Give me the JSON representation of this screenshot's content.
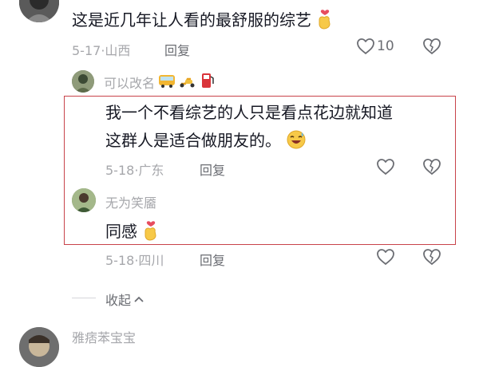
{
  "comment": {
    "text": "这是近几年让人看的最舒服的综艺",
    "date": "5-17",
    "location": "山西",
    "reply_label": "回复",
    "likes": "10"
  },
  "reply_header": {
    "username": "可以改名"
  },
  "reply1": {
    "text_line1": "我一个不看综艺的人只是看点花边就知道",
    "text_line2": "这群人是适合做朋友的。",
    "date": "5-18",
    "location": "广东",
    "reply_label": "回复"
  },
  "reply2": {
    "username": "无为笑靥",
    "text": "同感",
    "date": "5-18",
    "location": "四川",
    "reply_label": "回复"
  },
  "collapse": {
    "label": "收起"
  },
  "next_comment": {
    "username": "雅痞苯宝宝"
  },
  "separator": "·"
}
